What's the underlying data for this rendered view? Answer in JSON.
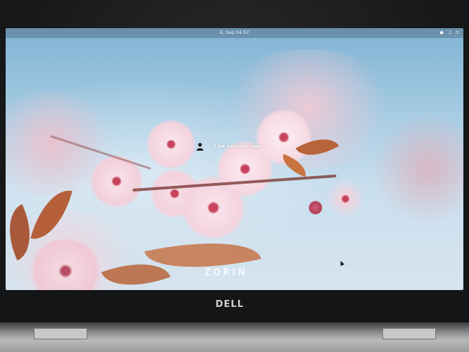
{
  "topbar": {
    "clock": "6. Sep 04:52",
    "tray_icons": [
      "network-icon",
      "volume-icon",
      "power-icon"
    ]
  },
  "login": {
    "username": "Live session user"
  },
  "wallpaper": {
    "brand": "ZORIN"
  },
  "laptop": {
    "logo": "DELL"
  },
  "colors": {
    "sky": "#a9cde4",
    "blossom": "#f4d7e0",
    "blossom_center": "#c8435a",
    "leaf": "#b8643a"
  }
}
